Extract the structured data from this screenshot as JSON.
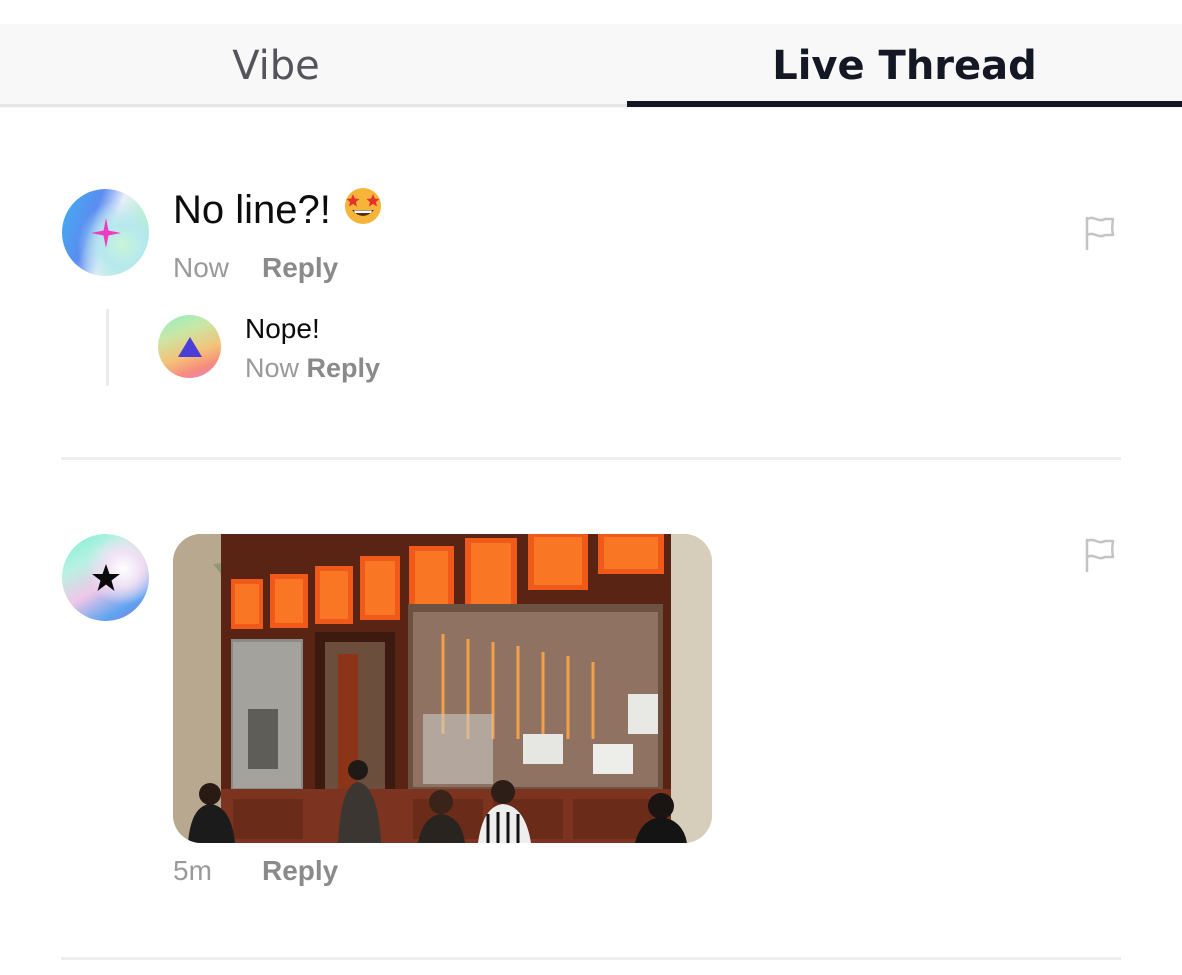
{
  "tabs": [
    {
      "label": "Vibe",
      "active": false
    },
    {
      "label": "Live Thread",
      "active": true
    }
  ],
  "thread": {
    "comment1": {
      "avatar_icon": "pink-sparkle-icon",
      "text": "No line?!",
      "emoji": "star-struck-emoji",
      "time": "Now",
      "reply_label": "Reply",
      "flag_icon": "flag-icon",
      "reply": {
        "avatar_icon": "purple-triangle-icon",
        "text": "Nope!",
        "time": "Now",
        "reply_label": "Reply"
      }
    },
    "comment2": {
      "avatar_icon": "black-star-icon",
      "image": "storefront-photo",
      "time": "5m",
      "reply_label": "Reply",
      "flag_icon": "flag-icon"
    }
  },
  "colors": {
    "active_tab": "#141824",
    "inactive_tab": "#54545c",
    "meta_text": "#9a9a9a",
    "divider": "#eeeeee"
  }
}
